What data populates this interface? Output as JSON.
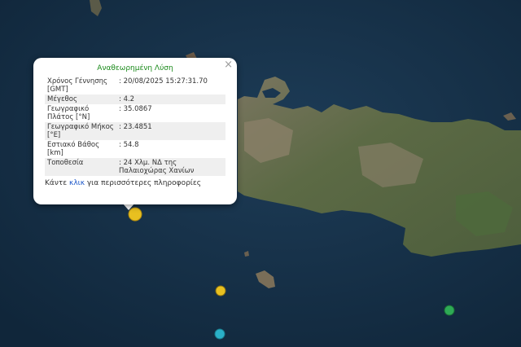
{
  "popup": {
    "title": "Αναθεωρημένη Λύση",
    "close_symbol": "×",
    "rows": [
      {
        "label": "Χρόνος Γέννησης [GMT]",
        "value": ": 20/08/2025 15:27:31.70"
      },
      {
        "label": "Μέγεθος",
        "value": ": 4.2"
      },
      {
        "label": "Γεωγραφικό Πλάτος [°N]",
        "value": ": 35.0867"
      },
      {
        "label": "Γεωγραφικό Μήκος [°E]",
        "value": ": 23.4851"
      },
      {
        "label": "Εστιακό Βάθος [km]",
        "value": ": 54.8"
      },
      {
        "label": "Τοποθεσία",
        "value": ": 24 Χλμ. ΝΔ της Παλαιοχώρας Χανίων"
      }
    ],
    "footer_before": "Κάντε ",
    "footer_link": "κλικ",
    "footer_after": " για περισσότερες πληροφορίες"
  },
  "markers": [
    {
      "color": "#e8c020",
      "role": "selected-event"
    },
    {
      "color": "#e8c020",
      "role": "event"
    },
    {
      "color": "#2ab0c8",
      "role": "event"
    },
    {
      "color": "#2eaa55",
      "role": "event"
    }
  ],
  "colors": {
    "sea": "#163048",
    "land": "#5f6a48",
    "title_green": "#1a8a1a",
    "link_blue": "#1a55c8"
  }
}
